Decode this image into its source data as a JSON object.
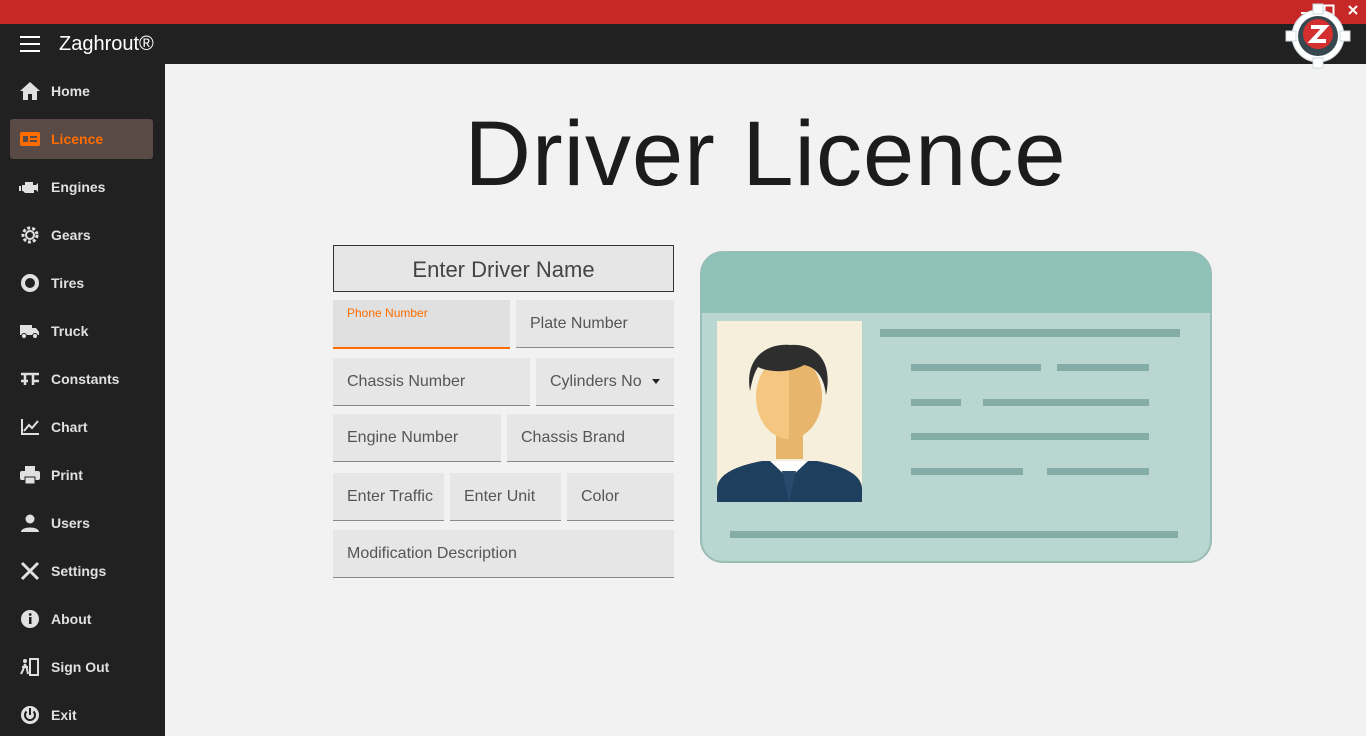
{
  "window": {
    "min": "▁",
    "max": "▢",
    "close": "✕"
  },
  "app": {
    "title": "Zaghrout®"
  },
  "sidebar": {
    "items": [
      {
        "label": "Home",
        "icon": "home-icon"
      },
      {
        "label": "Licence",
        "icon": "id-card-icon",
        "active": true
      },
      {
        "label": "Engines",
        "icon": "engine-icon"
      },
      {
        "label": "Gears",
        "icon": "gear-icon"
      },
      {
        "label": "Tires",
        "icon": "tire-icon"
      },
      {
        "label": "Truck",
        "icon": "truck-icon"
      },
      {
        "label": "Constants",
        "icon": "constants-icon"
      },
      {
        "label": "Chart",
        "icon": "chart-icon"
      },
      {
        "label": "Print",
        "icon": "print-icon"
      },
      {
        "label": "Users",
        "icon": "user-icon"
      },
      {
        "label": "Settings",
        "icon": "tools-icon"
      },
      {
        "label": "About",
        "icon": "info-icon"
      },
      {
        "label": "Sign Out",
        "icon": "sign-out-icon"
      },
      {
        "label": "Exit",
        "icon": "power-icon"
      }
    ]
  },
  "main": {
    "title": "Driver Licence",
    "form": {
      "driver_name": "Enter Driver Name",
      "phone_label": "Phone Number",
      "plate": "Plate Number",
      "chassis_number": "Chassis Number",
      "cylinders": "Cylinders No",
      "engine_number": "Engine Number",
      "chassis_brand": "Chassis Brand",
      "traffic": "Enter Traffic",
      "unit": "Enter Unit",
      "color": "Color",
      "modification": "Modification Description"
    }
  },
  "colors": {
    "accent": "#ff6d00",
    "titlebar": "#c62828",
    "sidebar": "#212121"
  }
}
